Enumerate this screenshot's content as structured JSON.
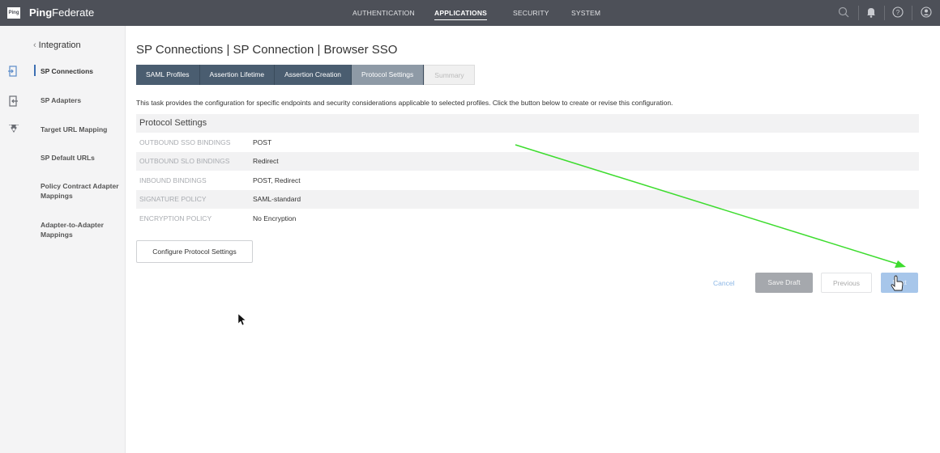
{
  "topbar": {
    "logo_text": "Ping",
    "brand_bold": "Ping",
    "brand_rest": "Federate",
    "nav": [
      "AUTHENTICATION",
      "APPLICATIONS",
      "SECURITY",
      "SYSTEM"
    ],
    "active_nav": "APPLICATIONS",
    "icons": [
      "search-icon",
      "bell-icon",
      "help-icon",
      "user-icon"
    ]
  },
  "sidebar": {
    "back_label": "Integration",
    "items": [
      {
        "label": "SP Connections",
        "icon": "connections-icon",
        "active": true
      },
      {
        "label": "SP Adapters",
        "icon": "adapter-icon"
      },
      {
        "label": "Target URL Mapping",
        "icon": "mapping-icon"
      },
      {
        "label": "SP Default URLs"
      },
      {
        "label": "Policy Contract Adapter Mappings"
      },
      {
        "label": "Adapter-to-Adapter Mappings"
      }
    ]
  },
  "breadcrumb": {
    "title": "SP Connections | SP Connection | Browser SSO"
  },
  "tabs": [
    {
      "label": "SAML Profiles"
    },
    {
      "label": "Assertion Lifetime"
    },
    {
      "label": "Assertion Creation"
    },
    {
      "label": "Protocol Settings",
      "active": true
    },
    {
      "label": "Summary",
      "disabled": true
    }
  ],
  "description": "This task provides the configuration for specific endpoints and security considerations applicable to selected profiles. Click the button below to create or revise this configuration.",
  "protocol": {
    "heading": "Protocol Settings",
    "rows": [
      {
        "label": "OUTBOUND SSO BINDINGS",
        "value": "POST"
      },
      {
        "label": "OUTBOUND SLO BINDINGS",
        "value": "Redirect"
      },
      {
        "label": "INBOUND BINDINGS",
        "value": "POST, Redirect"
      },
      {
        "label": "SIGNATURE POLICY",
        "value": "SAML-standard"
      },
      {
        "label": "ENCRYPTION POLICY",
        "value": "No Encryption"
      }
    ]
  },
  "actions": {
    "configure": "Configure Protocol Settings",
    "cancel": "Cancel",
    "save_draft": "Save Draft",
    "previous": "Previous",
    "next": "Next"
  },
  "colors": {
    "topbar": "#4d5058",
    "tab": "#4a5d70",
    "tab_active": "#8e9aa6",
    "next_button": "#a7c6ea",
    "annotation_arrow": "#3ddc2e"
  }
}
